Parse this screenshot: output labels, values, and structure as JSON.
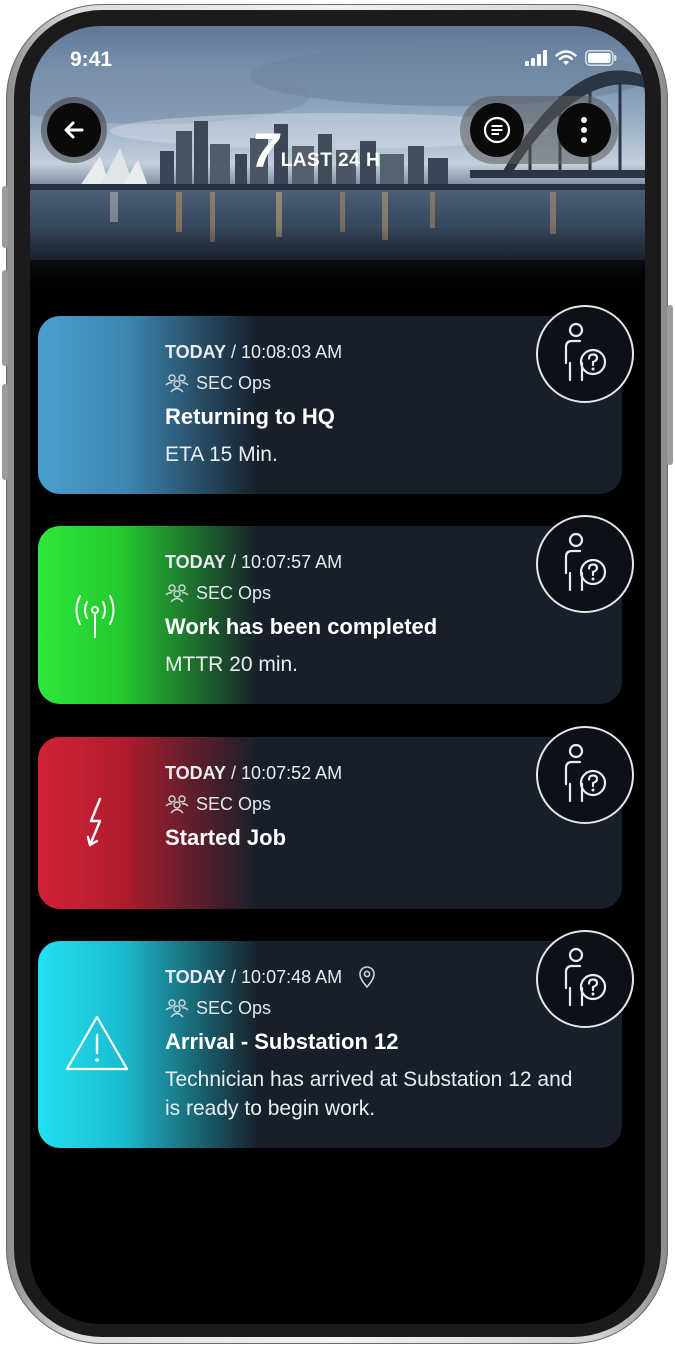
{
  "status_bar": {
    "time": "9:41"
  },
  "header": {
    "count": "7",
    "period_label": "LAST 24 H"
  },
  "toolbar": {
    "back_icon": "back-arrow-icon",
    "list_icon": "list-icon",
    "more_icon": "more-vertical-icon"
  },
  "messages": [
    {
      "day": "TODAY",
      "time": "10:08:03 AM",
      "team": "SEC Ops",
      "title": "Returning to HQ",
      "subtitle": "ETA 15 Min.",
      "accent_color": "#4a9fd0",
      "icon": "",
      "has_location": false
    },
    {
      "day": "TODAY",
      "time": "10:07:57 AM",
      "team": "SEC Ops",
      "title": "Work has been completed",
      "subtitle": "MTTR 20 min.",
      "accent_color": "#2ee83a",
      "icon": "signal-tower-icon",
      "has_location": false
    },
    {
      "day": "TODAY",
      "time": "10:07:52 AM",
      "team": "SEC Ops",
      "title": "Started Job",
      "subtitle": "",
      "accent_color": "#d42236",
      "icon": "lightning-icon",
      "has_location": false
    },
    {
      "day": "TODAY",
      "time": "10:07:48 AM",
      "team": "SEC Ops",
      "title": "Arrival - Substation 12",
      "subtitle": "Technician has arrived at Substation 12 and is ready to begin work.",
      "accent_color": "#22e0f2",
      "icon": "warning-triangle-icon",
      "has_location": true
    }
  ]
}
